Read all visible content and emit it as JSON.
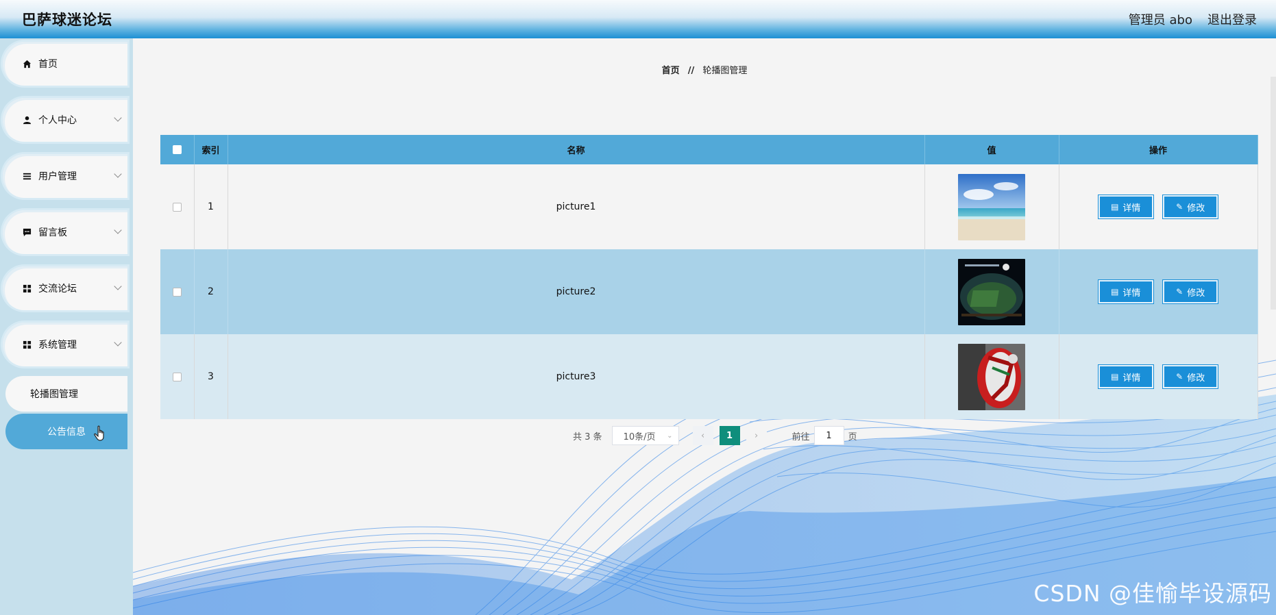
{
  "header": {
    "title": "巴萨球迷论坛",
    "user": "管理员 abo",
    "logout": "退出登录"
  },
  "sidebar": {
    "items": [
      {
        "label": "首页",
        "icon": "home-icon"
      },
      {
        "label": "个人中心",
        "icon": "person-icon"
      },
      {
        "label": "用户管理",
        "icon": "list-icon"
      },
      {
        "label": "留言板",
        "icon": "message-icon"
      },
      {
        "label": "交流论坛",
        "icon": "grid-icon"
      },
      {
        "label": "系统管理",
        "icon": "grid-icon"
      }
    ],
    "sub_items": [
      {
        "label": "轮播图管理",
        "state": "active"
      },
      {
        "label": "公告信息",
        "state": "highlight"
      }
    ]
  },
  "breadcrumb": {
    "home": "首页",
    "separator": "//",
    "current": "轮播图管理"
  },
  "table": {
    "headers": [
      "索引",
      "名称",
      "值",
      "操作"
    ],
    "rows": [
      {
        "index": "1",
        "name": "picture1",
        "image": "beach-image"
      },
      {
        "index": "2",
        "name": "picture2",
        "image": "stadium-image"
      },
      {
        "index": "3",
        "name": "picture3",
        "image": "soccer-ball-image"
      }
    ],
    "actions": {
      "detail": "详情",
      "edit": "修改"
    }
  },
  "pagination": {
    "total": "共 3 条",
    "page_size": "10条/页",
    "current_page": "1",
    "goto_label": "前往",
    "goto_value": "1",
    "page_unit": "页"
  },
  "watermark": "CSDN @佳愉毕设源码",
  "colors": {
    "header_blue": "#1d8fd4",
    "table_header": "#52a9d8",
    "button_blue": "#1a8fd8",
    "page_active": "#0f8e7c",
    "sidebar_bg": "#c6e0ec"
  }
}
